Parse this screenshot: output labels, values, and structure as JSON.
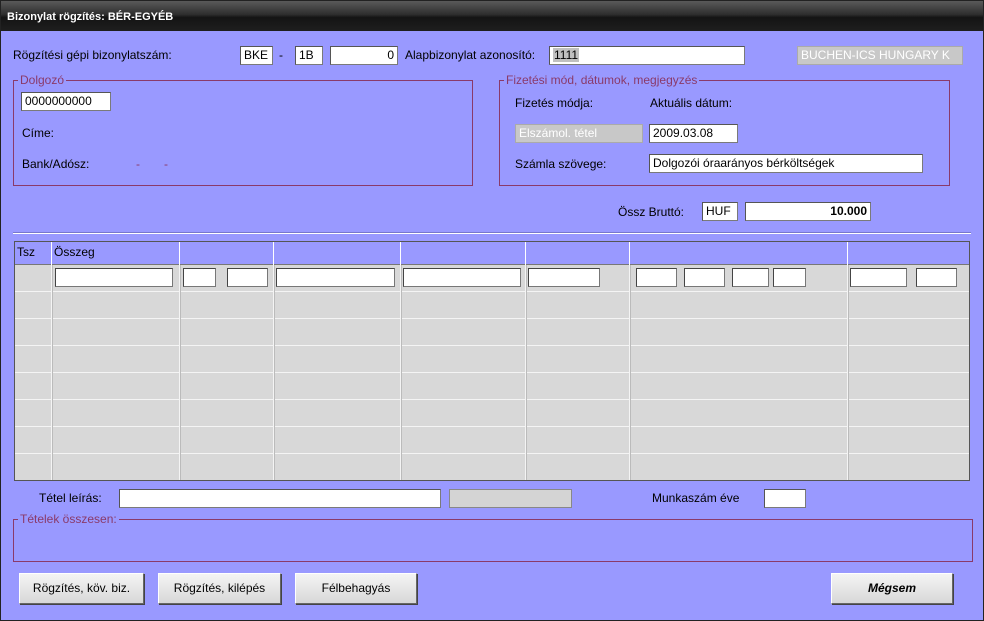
{
  "window": {
    "title": "Bizonylat rögzítés: BÉR-EGYÉB"
  },
  "header": {
    "doc_number_label": "Rögzítési gépi bizonylatszám:",
    "prefix_value": "BKE",
    "dash": "-",
    "series_value": "1B",
    "number_value": "0",
    "base_doc_label": "Alapbizonylat azonosító:",
    "base_doc_value": "1111",
    "company_value": "BUCHEN-ICS HUNGARY K"
  },
  "employee_group": {
    "title": "Dolgozó",
    "employee_id_value": "0000000000",
    "address_label": "Címe:",
    "bank_label": "Bank/Adósz:",
    "bank_dash1": "-",
    "bank_dash2": "-"
  },
  "payment_group": {
    "title": "Fizetési mód, dátumok, megjegyzés",
    "payment_mode_label": "Fizetés módja:",
    "current_date_label": "Aktuális dátum:",
    "payment_mode_value": "Elszámol. tétel",
    "current_date_value": "2009.03.08",
    "invoice_text_label": "Számla szövege:",
    "invoice_text_value": "Dolgozói óraarányos bérköltségek"
  },
  "totals": {
    "gross_label": "Össz Bruttó:",
    "currency_value": "HUF",
    "gross_value": "10.000"
  },
  "grid": {
    "columns": [
      "Tsz",
      "Összeg",
      "",
      "",
      "",
      "",
      "",
      ""
    ]
  },
  "footer": {
    "item_desc_label": "Tétel leírás:",
    "item_desc_value": "",
    "job_year_label": "Munkaszám éve",
    "job_year_value": "",
    "items_total_title": "Tételek összesen:"
  },
  "buttons": {
    "save_next": "Rögzítés, köv. biz.",
    "save_exit": "Rögzítés, kilépés",
    "pause": "Félbehagyás",
    "cancel": "Mégsem"
  }
}
